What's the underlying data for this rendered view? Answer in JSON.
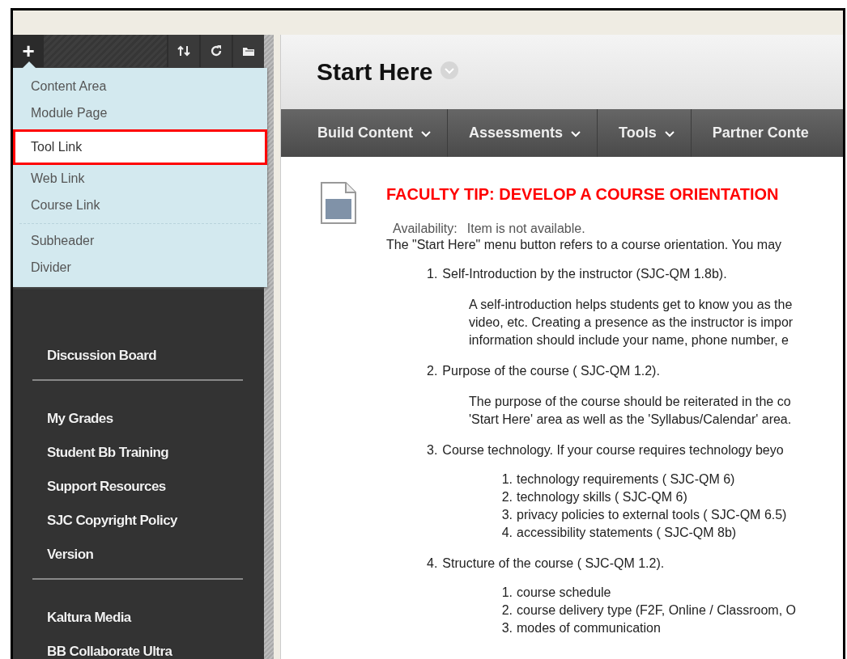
{
  "sidebar": {
    "add_button": "+",
    "add_menu": {
      "groups": [
        [
          {
            "label": "Content Area",
            "highlighted": false
          },
          {
            "label": "Module Page",
            "highlighted": false
          },
          {
            "label": "Tool Link",
            "highlighted": true
          },
          {
            "label": "Web Link",
            "highlighted": false
          },
          {
            "label": "Course Link",
            "highlighted": false
          }
        ],
        [
          {
            "label": "Subheader",
            "highlighted": false
          },
          {
            "label": "Divider",
            "highlighted": false
          }
        ]
      ]
    },
    "link_groups": [
      [
        "Discussion Board"
      ],
      [
        "My Grades",
        "Student Bb Training",
        "Support Resources",
        "SJC Copyright Policy",
        "Version"
      ],
      [
        "Kaltura Media",
        "BB Collaborate Ultra"
      ]
    ]
  },
  "page": {
    "title": "Start Here",
    "actions": [
      "Build Content",
      "Assessments",
      "Tools",
      "Partner Conte"
    ],
    "item": {
      "title": "FACULTY TIP: DEVELOP A COURSE ORIENTATION",
      "availability_label": "Availability:",
      "availability_value": "Item is not available.",
      "intro": "The \"Start Here\" menu button refers to a course orientation. You may",
      "points": [
        {
          "number": "1.",
          "text": "Self-Introduction by the instructor (SJC-QM 1.8b).",
          "kind": "paragraph",
          "lines": [
            "A self-introduction helps students get to know you as the",
            "video, etc. Creating a presence as the instructor is impor",
            "information should include your name, phone number, e"
          ]
        },
        {
          "number": "2.",
          "text": "Purpose of the course ( SJC-QM 1.2).",
          "kind": "paragraph",
          "lines": [
            "The purpose of the course should be reiterated in the co",
            "'Start Here' area as well as the 'Syllabus/Calendar' area."
          ]
        },
        {
          "number": "3.",
          "text": "Course technology. If your course requires technology beyo",
          "kind": "list",
          "lines": [
            {
              "number": "1.",
              "text": "technology requirements ( SJC-QM 6)"
            },
            {
              "number": "2.",
              "text": "technology skills ( SJC-QM 6)"
            },
            {
              "number": "3.",
              "text": "privacy policies to external tools ( SJC-QM 6.5)"
            },
            {
              "number": "4.",
              "text": "accessibility statements ( SJC-QM 8b)"
            }
          ]
        },
        {
          "number": "4.",
          "text": "Structure of the course ( SJC-QM 1.2).",
          "kind": "list",
          "lines": [
            {
              "number": "1.",
              "text": "course schedule"
            },
            {
              "number": "2.",
              "text": "course delivery type (F2F, Online / Classroom, O"
            },
            {
              "number": "3.",
              "text": "modes of communication"
            }
          ]
        }
      ]
    }
  }
}
